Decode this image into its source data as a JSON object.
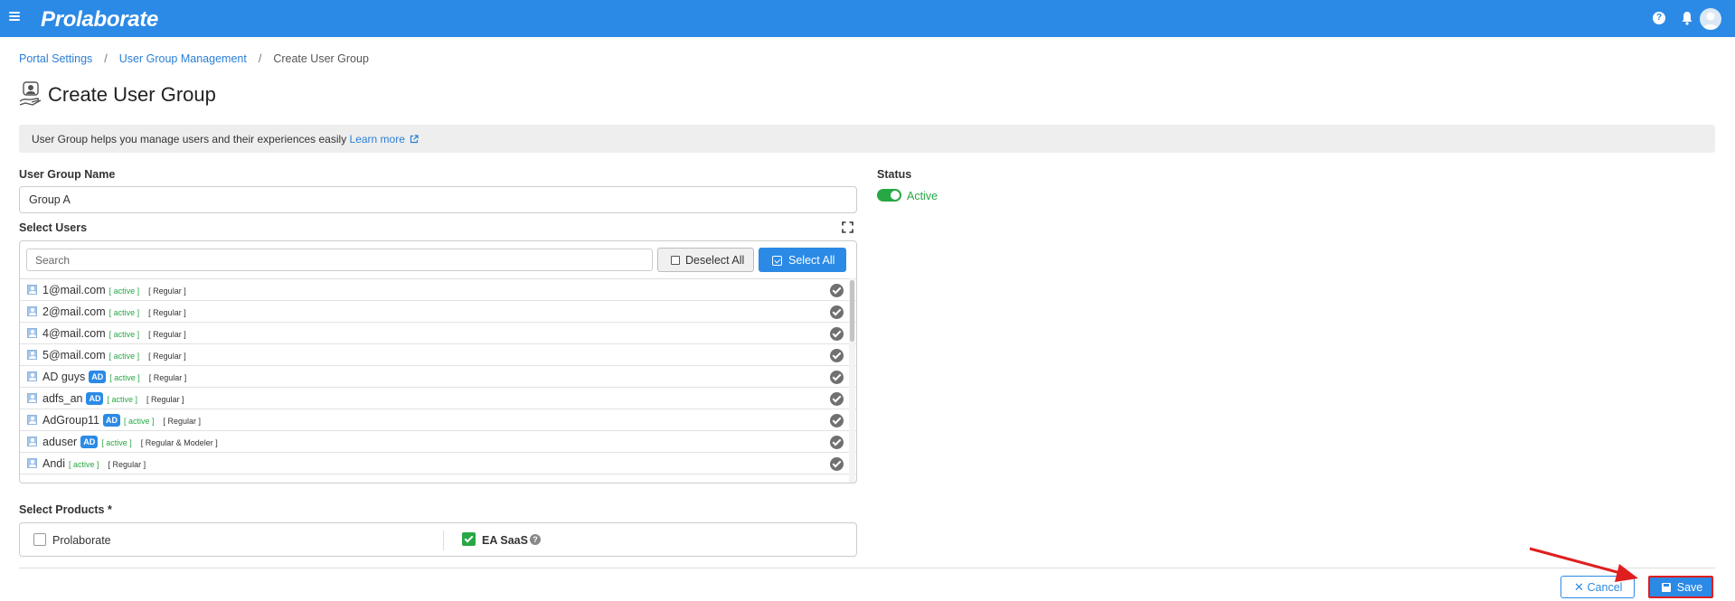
{
  "app": {
    "logo": "Prolaborate"
  },
  "breadcrumb": {
    "items": [
      "Portal Settings",
      "User Group Management",
      "Create User Group"
    ],
    "separator": "/"
  },
  "page": {
    "title": "Create User Group",
    "info_text": "User Group helps you manage users and their experiences easily",
    "info_link": "Learn more"
  },
  "form": {
    "group_name_label": "User Group Name",
    "group_name_value": "Group A",
    "status_label": "Status",
    "status_value": "Active",
    "status_on": true,
    "select_users_label": "Select Users",
    "search_placeholder": "Search",
    "deselect_all_label": "Deselect All",
    "select_all_label": "Select All",
    "users": [
      {
        "name": "1@mail.com",
        "ad": "",
        "status": "[ active ]",
        "role": "[ Regular ]",
        "selected": true
      },
      {
        "name": "2@mail.com",
        "ad": "",
        "status": "[ active ]",
        "role": "[ Regular ]",
        "selected": true
      },
      {
        "name": "4@mail.com",
        "ad": "",
        "status": "[ active ]",
        "role": "[ Regular ]",
        "selected": true
      },
      {
        "name": "5@mail.com",
        "ad": "",
        "status": "[ active ]",
        "role": "[ Regular ]",
        "selected": true
      },
      {
        "name": "AD guys",
        "ad": "AD",
        "status": "[ active ]",
        "role": "[ Regular ]",
        "selected": true
      },
      {
        "name": "adfs_an",
        "ad": "AD",
        "status": "[ active ]",
        "role": "[ Regular ]",
        "selected": true
      },
      {
        "name": "AdGroup11",
        "ad": "AD",
        "status": "[ active ]",
        "role": "[ Regular ]",
        "selected": true
      },
      {
        "name": "aduser",
        "ad": "AD",
        "status": "[ active ]",
        "role": "[ Regular & Modeler ]",
        "selected": true
      },
      {
        "name": "Andi",
        "ad": "",
        "status": "[ active ]",
        "role": "[ Regular ]",
        "selected": true
      }
    ],
    "select_products_label": "Select Products *",
    "products": [
      {
        "name": "Prolaborate",
        "checked": false
      },
      {
        "name": "EA SaaS",
        "checked": true
      }
    ]
  },
  "actions": {
    "cancel_label": "Cancel",
    "save_label": "Save"
  },
  "colors": {
    "header": "#2b8ae6",
    "link": "#2b7fd6",
    "active_green": "#28a745",
    "highlight_red": "#e01e1e"
  }
}
